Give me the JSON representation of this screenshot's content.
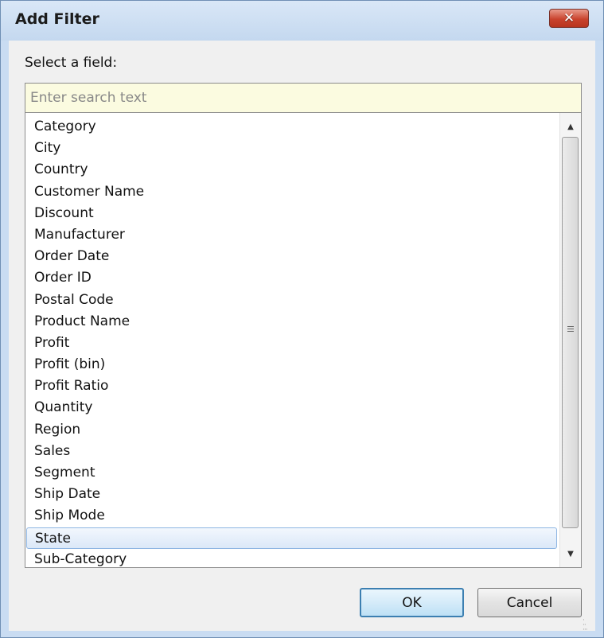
{
  "window": {
    "title": "Add Filter",
    "close_label": "✕"
  },
  "field_label": "Select a field:",
  "search": {
    "placeholder": "Enter search text",
    "value": ""
  },
  "fields": [
    "Category",
    "City",
    "Country",
    "Customer Name",
    "Discount",
    "Manufacturer",
    "Order Date",
    "Order ID",
    "Postal Code",
    "Product Name",
    "Profit",
    "Profit (bin)",
    "Profit Ratio",
    "Quantity",
    "Region",
    "Sales",
    "Segment",
    "Ship Date",
    "Ship Mode",
    "State",
    "Sub-Category"
  ],
  "selected_field": "State",
  "buttons": {
    "ok": "OK",
    "cancel": "Cancel"
  },
  "icons": {
    "close": "close-icon",
    "scroll_up": "chevron-up-icon",
    "scroll_down": "chevron-down-icon",
    "resize": "resize-grip-icon"
  },
  "colors": {
    "search_bg": "#fbfbe0",
    "selected_bg": "#dbe8f8",
    "close_red": "#c9432d"
  }
}
